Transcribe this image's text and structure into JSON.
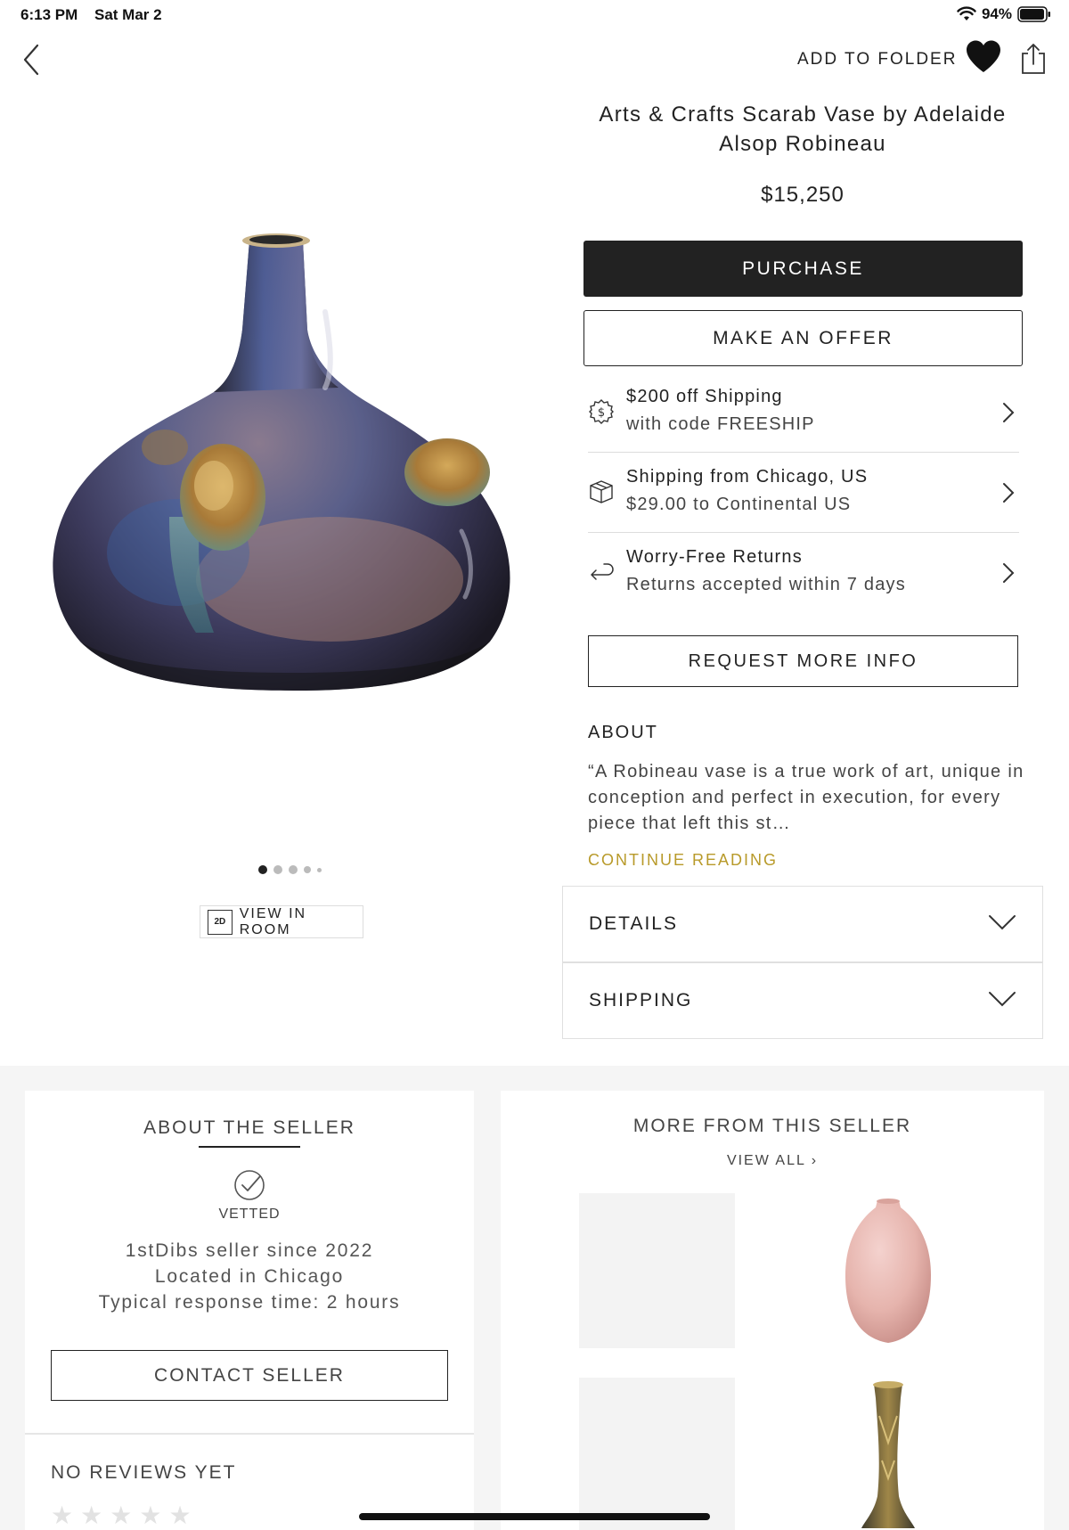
{
  "status_bar": {
    "time": "6:13 PM",
    "date": "Sat Mar 2",
    "battery": "94%"
  },
  "nav": {
    "add_to_folder": "ADD TO FOLDER",
    "icons": [
      "back-chevron-icon",
      "heart-icon",
      "share-icon"
    ]
  },
  "product": {
    "title": "Arts & Crafts Scarab Vase by Adelaide Alsop Robineau",
    "price": "$15,250",
    "purchase_label": "PURCHASE",
    "offer_label": "MAKE AN OFFER",
    "view_in_room_badge": "2D",
    "view_in_room_label": "VIEW IN ROOM",
    "carousel": {
      "count": 5,
      "active": 0
    }
  },
  "info_rows": [
    {
      "line1": "$200 off Shipping",
      "line2": "with code FREESHIP",
      "icon": "dollar-badge-icon"
    },
    {
      "line1": "Shipping from Chicago, US",
      "line2": "$29.00 to Continental US",
      "icon": "package-icon"
    },
    {
      "line1": "Worry-Free Returns",
      "line2": "Returns accepted within 7 days",
      "icon": "return-arrow-icon"
    }
  ],
  "request_info_label": "REQUEST MORE INFO",
  "about": {
    "heading": "ABOUT",
    "text": "“A Robineau vase is a true work of art, unique in conception and perfect in execution, for every piece that left this st…",
    "continue_label": "CONTINUE READING"
  },
  "accordions": {
    "details": "DETAILS",
    "shipping": "SHIPPING"
  },
  "seller": {
    "heading": "ABOUT THE SELLER",
    "vetted": "VETTED",
    "since": "1stDibs seller since 2022",
    "location": "Located in Chicago",
    "response": "Typical response time: 2 hours",
    "contact_label": "CONTACT SELLER",
    "reviews_label": "NO REVIEWS YET",
    "rating_stars": 0
  },
  "more_from_seller": {
    "heading": "MORE FROM THIS SELLER",
    "view_all": "VIEW ALL ›"
  },
  "colors": {
    "primary": "#222222",
    "accent": "#b89a2a",
    "divider": "#dddddd",
    "section_bg": "#f5f5f5"
  }
}
